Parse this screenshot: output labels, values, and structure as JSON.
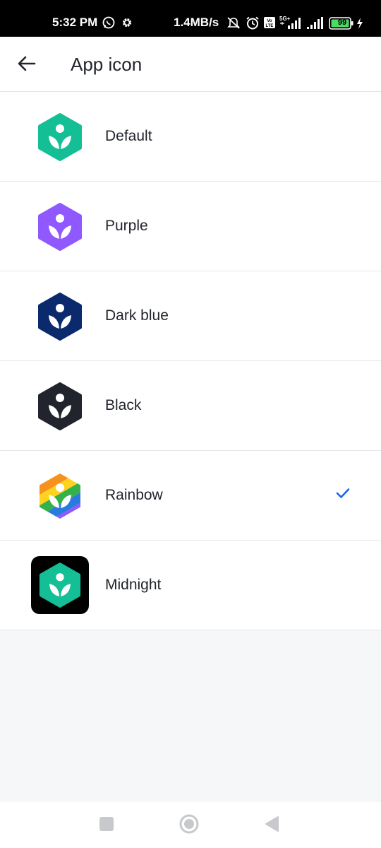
{
  "status_bar": {
    "time": "5:32 PM",
    "speed": "1.4MB/s",
    "battery": "99",
    "icons": [
      "whatsapp-icon",
      "gear-icon",
      "mute-icon",
      "alarm-icon",
      "volte-icon",
      "signal-5g-icon",
      "signal-icon",
      "battery-icon",
      "charging-icon"
    ]
  },
  "app_bar": {
    "title": "App icon",
    "back_icon": "arrow-left-icon"
  },
  "colors": {
    "default": "#14bf96",
    "purple": "#9059ff",
    "dark_blue": "#0b2a6e",
    "black": "#21242c",
    "midnight": "#14bf96",
    "check": "#1865f2"
  },
  "app_icons": [
    {
      "label": "Default",
      "icon": "default-app-icon",
      "selected": false
    },
    {
      "label": "Purple",
      "icon": "purple-app-icon",
      "selected": false
    },
    {
      "label": "Dark blue",
      "icon": "dark-blue-app-icon",
      "selected": false
    },
    {
      "label": "Black",
      "icon": "black-app-icon",
      "selected": false
    },
    {
      "label": "Rainbow",
      "icon": "rainbow-app-icon",
      "selected": true
    },
    {
      "label": "Midnight",
      "icon": "midnight-app-icon",
      "selected": false
    }
  ],
  "nav_bar": {
    "buttons": [
      "recents-button",
      "home-button",
      "back-button"
    ]
  }
}
